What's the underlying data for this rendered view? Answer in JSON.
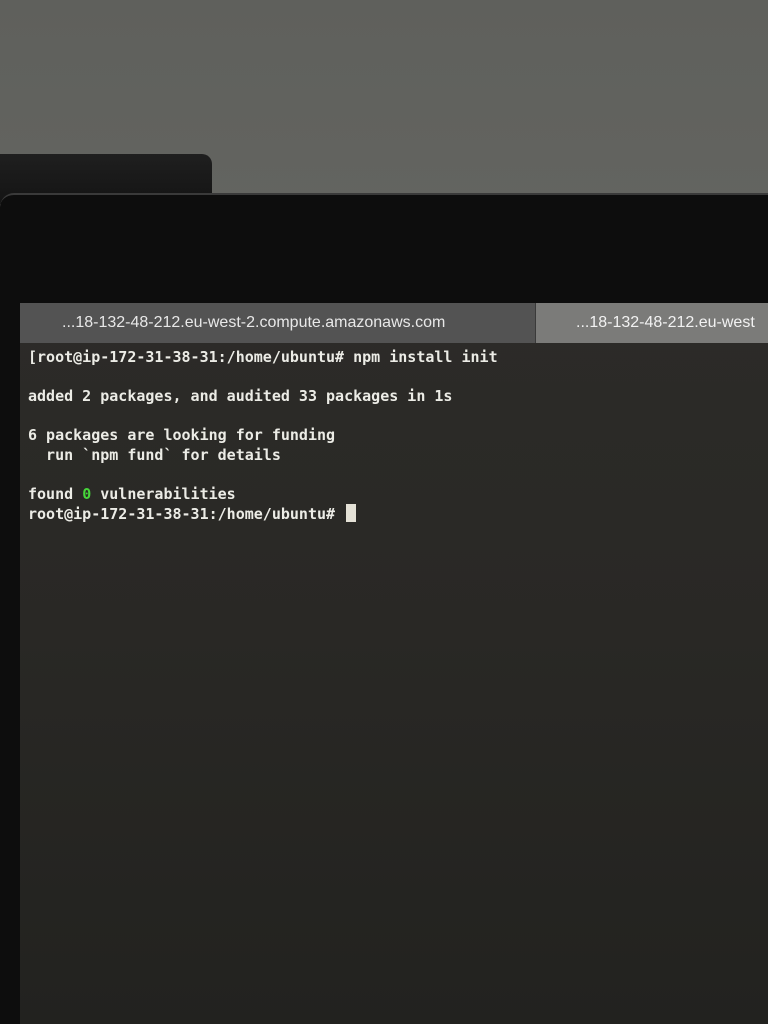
{
  "tabs": [
    {
      "label": "...18-132-48-212.eu-west-2.compute.amazonaws.com"
    },
    {
      "label": "...18-132-48-212.eu-west"
    }
  ],
  "terminal": {
    "line1": "[root@ip-172-31-38-31:/home/ubuntu# npm install init",
    "line2": "added 2 packages, and audited 33 packages in 1s",
    "line3": "6 packages are looking for funding",
    "line4": "  run `npm fund` for details",
    "line5_prefix": "found ",
    "line5_count": "0",
    "line5_suffix": " vulnerabilities",
    "prompt": "root@ip-172-31-38-31:/home/ubuntu# "
  },
  "colors": {
    "terminal_background": "#2a2926",
    "terminal_text": "#ecece6",
    "vulnerability_count": "#46d63a",
    "active_tab": "#7b7b79",
    "inactive_tab": "#535353"
  }
}
